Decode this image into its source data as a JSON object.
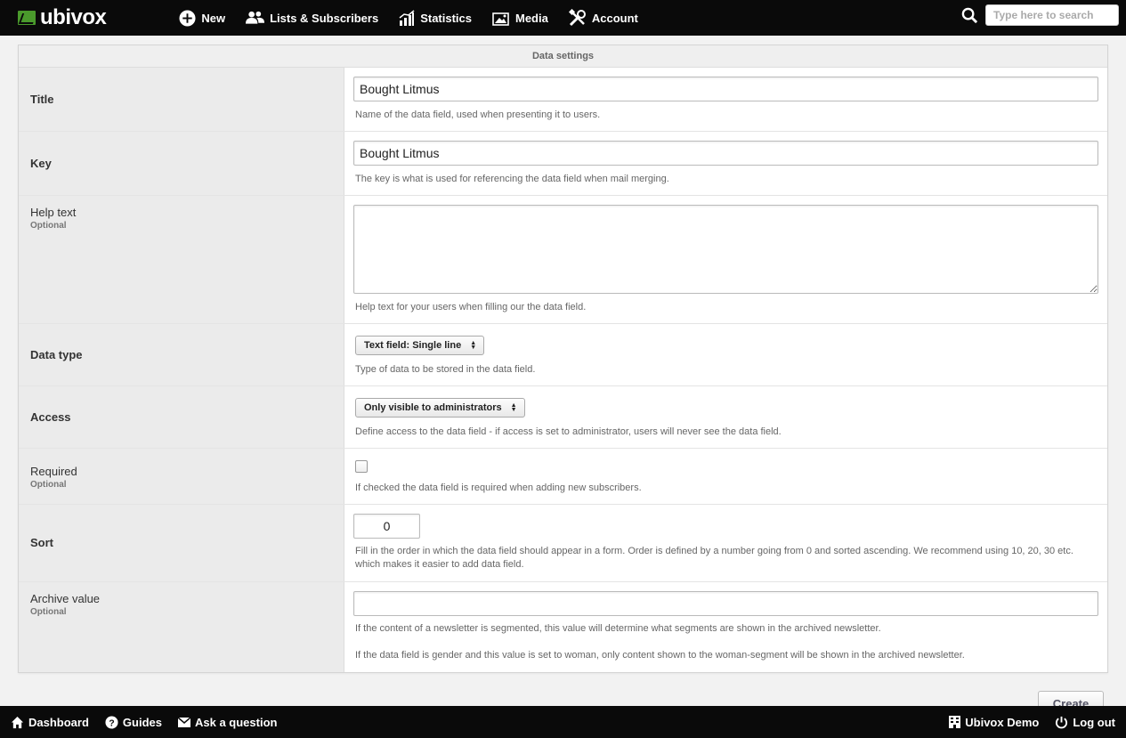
{
  "brand": {
    "name": "ubivox"
  },
  "nav": [
    {
      "label": "New",
      "icon": "plus-circle-icon"
    },
    {
      "label": "Lists & Subscribers",
      "icon": "users-icon"
    },
    {
      "label": "Statistics",
      "icon": "chart-icon"
    },
    {
      "label": "Media",
      "icon": "image-icon"
    },
    {
      "label": "Account",
      "icon": "tools-icon"
    }
  ],
  "search": {
    "placeholder": "Type here to search"
  },
  "panel": {
    "header": "Data settings",
    "fields": {
      "title": {
        "label": "Title",
        "value": "Bought Litmus",
        "help": "Name of the data field, used when presenting it to users."
      },
      "key": {
        "label": "Key",
        "value": "Bought Litmus",
        "help": "The key is what is used for referencing the data field when mail merging."
      },
      "help_text": {
        "label": "Help text",
        "optional": "Optional",
        "value": "",
        "help": "Help text for your users when filling our the data field."
      },
      "data_type": {
        "label": "Data type",
        "selected": "Text field: Single line",
        "help": "Type of data to be stored in the data field."
      },
      "access": {
        "label": "Access",
        "selected": "Only visible to administrators",
        "help": "Define access to the data field - if access is set to administrator, users will never see the data field."
      },
      "required": {
        "label": "Required",
        "optional": "Optional",
        "checked": false,
        "help": "If checked the data field is required when adding new subscribers."
      },
      "sort": {
        "label": "Sort",
        "value": "0",
        "help_line1": "Fill in the order in which the data field should appear in a form. Order is defined by a number going from 0 and sorted ascending. We recommend using 10, 20, 30 etc.",
        "help_line2": "which makes it easier to add data field."
      },
      "archive_value": {
        "label": "Archive value",
        "optional": "Optional",
        "value": "",
        "help_line1": "If the content of a newsletter is segmented, this value will determine what segments are shown in the archived newsletter.",
        "help_line2": "If the data field is gender and this value is set to woman, only content shown to the woman-segment will be shown in the archived newsletter."
      }
    }
  },
  "create_label": "Create",
  "footer": {
    "left": [
      {
        "label": "Dashboard",
        "icon": "home-icon"
      },
      {
        "label": "Guides",
        "icon": "help-icon"
      },
      {
        "label": "Ask a question",
        "icon": "mail-icon"
      }
    ],
    "right": [
      {
        "label": "Ubivox Demo",
        "icon": "building-icon"
      },
      {
        "label": "Log out",
        "icon": "power-icon"
      }
    ]
  }
}
